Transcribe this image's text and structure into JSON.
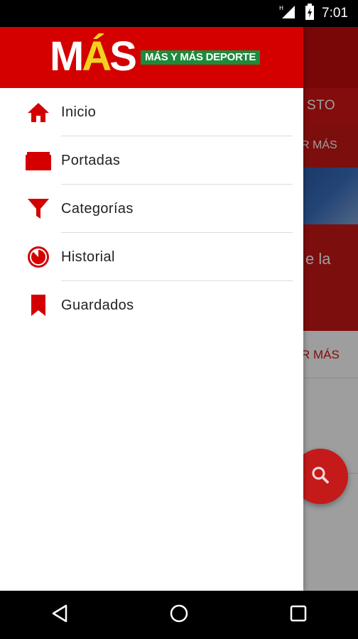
{
  "status_bar": {
    "time": "7:01",
    "icons": [
      "signal-icon",
      "battery-charging-icon"
    ]
  },
  "background": {
    "tab_partial": "STO",
    "ver_mas_1": "R MÁS",
    "caption_partial": "e la",
    "ver_mas_2": "R MÁS"
  },
  "drawer": {
    "logo_main_prefix": "M",
    "logo_main_accent": "Á",
    "logo_main_suffix": "S",
    "logo_badge": "MÁS Y MÁS DEPORTE",
    "items": [
      {
        "label": "Inicio",
        "icon": "home-icon"
      },
      {
        "label": "Portadas",
        "icon": "folder-icon"
      },
      {
        "label": "Categorías",
        "icon": "filter-icon"
      },
      {
        "label": "Historial",
        "icon": "timer-icon"
      },
      {
        "label": "Guardados",
        "icon": "bookmark-icon"
      }
    ]
  },
  "fab": {
    "icon": "search-icon"
  },
  "nav_bar": {
    "buttons": [
      "back-icon",
      "home-circle-icon",
      "recents-icon"
    ]
  },
  "colors": {
    "brand_red": "#d40000",
    "accent_yellow": "#f3d21f",
    "badge_green": "#1d8a3c"
  }
}
